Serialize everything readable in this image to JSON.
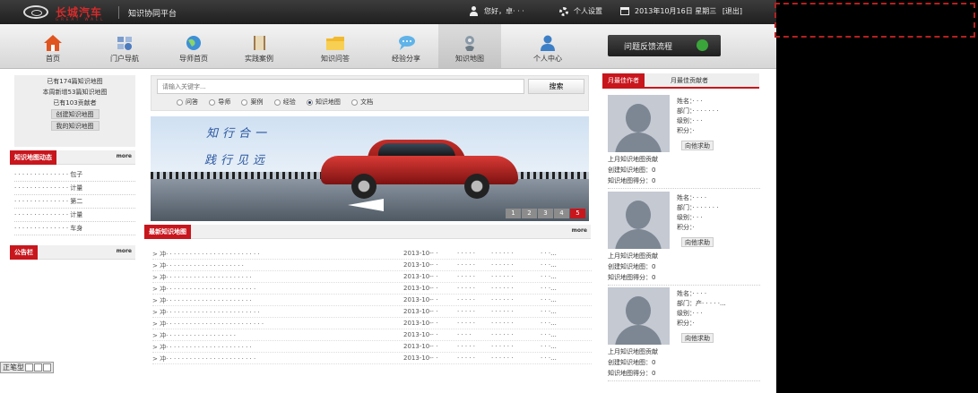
{
  "header": {
    "brand": "长城汽车",
    "brand_tagline": "GREAT WALL",
    "platform": "知识协同平台",
    "greeting": "您好，卓· · ·",
    "settings": "个人设置",
    "date": "2013年10月16日 星期三",
    "logout": "[退出]"
  },
  "nav": {
    "items": [
      {
        "label": "首页",
        "icon": "home-icon"
      },
      {
        "label": "门户导航",
        "icon": "portal-nav-icon"
      },
      {
        "label": "导师首页",
        "icon": "globe-icon"
      },
      {
        "label": "实践案例",
        "icon": "book-icon"
      },
      {
        "label": "知识问答",
        "icon": "folder-icon"
      },
      {
        "label": "经验分享",
        "icon": "chat-icon"
      },
      {
        "label": "知识地图",
        "icon": "map-icon"
      },
      {
        "label": "个人中心",
        "icon": "person-icon"
      }
    ],
    "active": "知识地图",
    "feedback": "问题反馈流程"
  },
  "left": {
    "stat1": "已有174篇知识地图",
    "stat2": "本周新增53篇知识地图",
    "stat3": "已有103贡献者",
    "create_btn": "创建知识地图",
    "mine_btn": "我的知识地图",
    "dynamics_title": "知识地图动态",
    "more": "more",
    "dynamics": [
      "· · · · · · · · · · · · · · 包子",
      "· · · · · · · · · · · · · · 计量",
      "· · · · · · · · · · · · · · 第二",
      "· · · · · · · · · · · · · · 计量",
      "· · · · · · · · · · · · · · 车身"
    ],
    "notice_title": "公告栏"
  },
  "search": {
    "placeholder": "请输入关键字...",
    "button": "搜索",
    "options": [
      "问答",
      "导师",
      "案例",
      "经验",
      "知识地图",
      "文档"
    ],
    "selected": "知识地图"
  },
  "banner": {
    "slogan1": "知行合一",
    "slogan2": "践行见远",
    "slides": [
      "1",
      "2",
      "3",
      "4",
      "5"
    ],
    "current_slide": "5"
  },
  "latest": {
    "title": "最新知识地图",
    "more": "more",
    "rows": [
      {
        "title": "> 冲· · · · · · · · · · · · · · · · · · · · · · · ·",
        "date": "2013-10-· ·",
        "c1": "· · · · ·",
        "c2": "· · · · · ·",
        "c3": "· · ·..."
      },
      {
        "title": "> 冲· · · · · · · · · · · · · · · · · · · ·",
        "date": "2013-10-· ·",
        "c1": "· · · · ·",
        "c2": "· · · · · ·",
        "c3": "· · ·..."
      },
      {
        "title": "> 冲· · · · · · · · · · · · · · · · · · · · · ·",
        "date": "2013-10-· ·",
        "c1": "· · · · ·",
        "c2": "· · · · · ·",
        "c3": "· · ·..."
      },
      {
        "title": "> 冲· · · · · · · · · · · · · · · · · · · · · · ·",
        "date": "2013-10-· ·",
        "c1": "· · · · ·",
        "c2": "· · · · · ·",
        "c3": "· · ·..."
      },
      {
        "title": "> 冲· · · · · · · · · · · · · · · · · · · · · ·",
        "date": "2013-10-· ·",
        "c1": "· · · · ·",
        "c2": "· · · · · ·",
        "c3": "· · ·..."
      },
      {
        "title": "> 冲· · · · · · · · · · · · · · · · · · · · · · · ·",
        "date": "2013-10-· ·",
        "c1": "· · · · ·",
        "c2": "· · · · · ·",
        "c3": "· · ·..."
      },
      {
        "title": "> 冲· · · · · · · · · · · · · · · · · · · · · · · · ·",
        "date": "2013-10-· ·",
        "c1": "· · · · ·",
        "c2": "· · · · · ·",
        "c3": "· · ·..."
      },
      {
        "title": "> 冲· · · · · · · · · · · · · · · · · ·",
        "date": "2013-10-· ·",
        "c1": "· · · ·",
        "c2": "· · · · · ·",
        "c3": "· · ·..."
      },
      {
        "title": "> 冲· · · · · · · · · · · · · · · · · · · · · ·",
        "date": "2013-10-· ·",
        "c1": "· · · · ·",
        "c2": "· · · · · ·",
        "c3": "· · ·..."
      },
      {
        "title": "> 冲· · · · · · · · · · · · · · · · · · · · · · ·",
        "date": "2013-10-· ·",
        "c1": "· · · · ·",
        "c2": "· · · · · ·",
        "c3": "· · ·..."
      }
    ]
  },
  "right": {
    "tab1": "月最佳作者",
    "tab2": "月最佳贡献者",
    "labels": {
      "name": "姓名：",
      "dept": "部门：",
      "level": "级别：",
      "points": "积分："
    },
    "ask": "向他求助",
    "contrib": "上月知识地图贡献",
    "created": "创建知识地图：",
    "score": "知识地图得分：",
    "profiles": [
      {
        "name": "· · ·",
        "dept": "· · · · · · ·",
        "level": "· · ·",
        "points": "·",
        "created_val": "0",
        "score_val": "0"
      },
      {
        "name": "· · · ·",
        "dept": "· · · · · · ·",
        "level": "· · ·",
        "points": "·",
        "created_val": "0",
        "score_val": "0"
      },
      {
        "name": "· · · ·",
        "dept": "产· · · · ·...",
        "level": "· · ·",
        "points": "·",
        "created_val": "0",
        "score_val": "0"
      }
    ]
  },
  "wordbar": {
    "label": "正笔型"
  }
}
